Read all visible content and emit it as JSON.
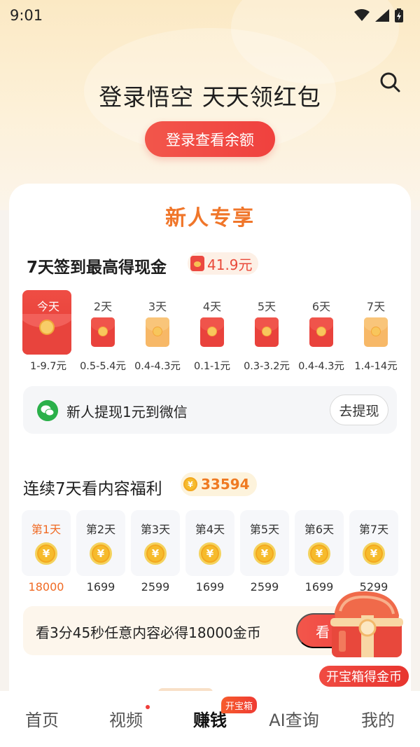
{
  "status_bar": {
    "time": "9:01"
  },
  "hero": {
    "title": "登录悟空 天天领红包",
    "login_button": "登录查看余额"
  },
  "card": {
    "title": "新人专享",
    "checkin": {
      "title": "7天签到最高得现金",
      "max_amount": "41.9元",
      "days": [
        {
          "label": "今天",
          "range": "1-9.7元",
          "style": "active"
        },
        {
          "label": "2天",
          "range": "0.5-5.4元",
          "style": "red"
        },
        {
          "label": "3天",
          "range": "0.4-4.3元",
          "style": "gold"
        },
        {
          "label": "4天",
          "range": "0.1-1元",
          "style": "red"
        },
        {
          "label": "5天",
          "range": "0.3-3.2元",
          "style": "red"
        },
        {
          "label": "6天",
          "range": "0.4-4.3元",
          "style": "red"
        },
        {
          "label": "7天",
          "range": "1.4-14元",
          "style": "gold"
        }
      ]
    },
    "withdraw": {
      "text": "新人提现1元到微信",
      "button": "去提现"
    },
    "watch_bonus": {
      "title": "连续7天看内容福利",
      "coins_total": "33594",
      "coin_symbol": "¥",
      "days": [
        {
          "label": "第1天",
          "amount": "18000"
        },
        {
          "label": "第2天",
          "amount": "1699"
        },
        {
          "label": "第3天",
          "amount": "2599"
        },
        {
          "label": "第4天",
          "amount": "1699"
        },
        {
          "label": "第5天",
          "amount": "2599"
        },
        {
          "label": "第6天",
          "amount": "1699"
        },
        {
          "label": "第7天",
          "amount": "5299"
        }
      ],
      "task_text": "看3分45秒任意内容必得18000金币",
      "task_button": "看"
    }
  },
  "chest": {
    "label": "开宝箱得金币"
  },
  "tabbar": {
    "tabs": [
      "首页",
      "视频",
      "赚钱",
      "AI查询",
      "我的"
    ],
    "active": "赚钱",
    "earn_badge": "开宝箱"
  }
}
